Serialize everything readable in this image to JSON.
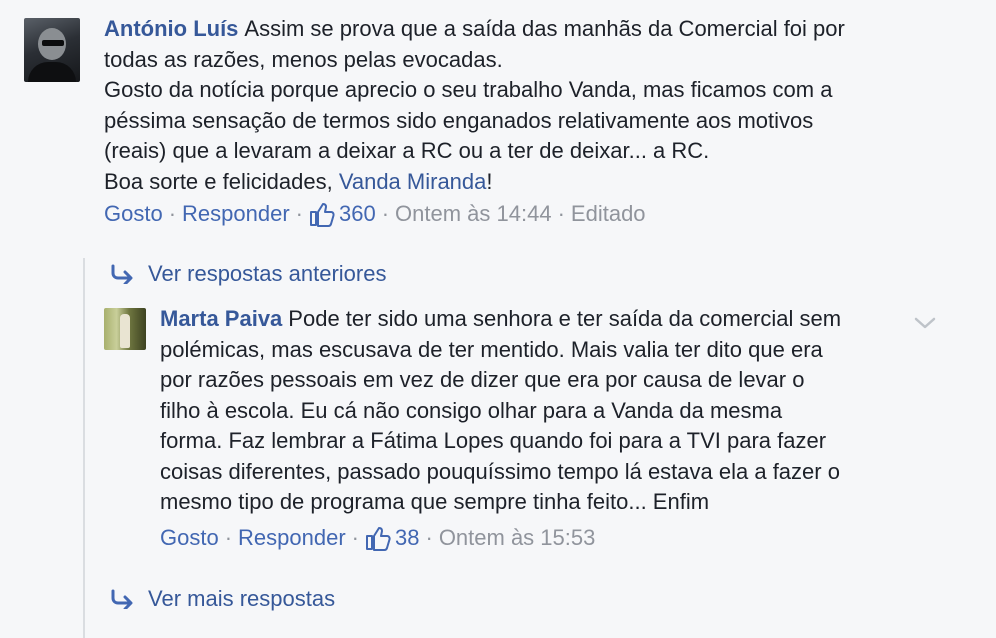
{
  "main_comment": {
    "author": "António Luís",
    "text_before_mention": "Assim se prova que a saída das manhãs da Comercial foi por\ntodas as razões, menos pelas evocadas.\nGosto da notícia porque aprecio o seu trabalho Vanda, mas ficamos com a\npéssima sensação de termos sido enganados relativamente aos motivos\n(reais) que a levaram a deixar a RC ou a ter de deixar... a RC.\nBoa sorte e felicidades, ",
    "mention": "Vanda Miranda",
    "text_after_mention": "!",
    "actions": {
      "like": "Gosto",
      "reply": "Responder",
      "reactions": "360",
      "time": "Ontem às 14:44",
      "edited": "Editado"
    }
  },
  "view_previous_replies": "Ver respostas anteriores",
  "reply": {
    "author": "Marta Paiva",
    "text": "Pode ter sido uma senhora e ter saída da comercial sem\npolémicas, mas escusava de ter mentido. Mais valia ter dito que era\npor razões pessoais em vez de dizer que era por causa de levar o\nfilho à escola. Eu cá não consigo olhar para a Vanda da mesma\nforma. Faz lembrar a Fátima Lopes quando foi para a TVI para fazer\ncoisas diferentes, passado pouquíssimo tempo lá estava ela a fazer o\nmesmo tipo de programa que sempre tinha feito... Enfim",
    "actions": {
      "like": "Gosto",
      "reply": "Responder",
      "reactions": "38",
      "time": "Ontem às 15:53"
    }
  },
  "view_more_replies": "Ver mais respostas",
  "colors": {
    "link": "#365899",
    "action_link": "#4267b2",
    "meta": "#90949c",
    "text": "#1d2129",
    "background": "#f6f7f9"
  },
  "icons": {
    "like": "thumbs-up-icon",
    "reply_arrow": "reply-arrow-icon",
    "options": "chevron-down-icon"
  }
}
